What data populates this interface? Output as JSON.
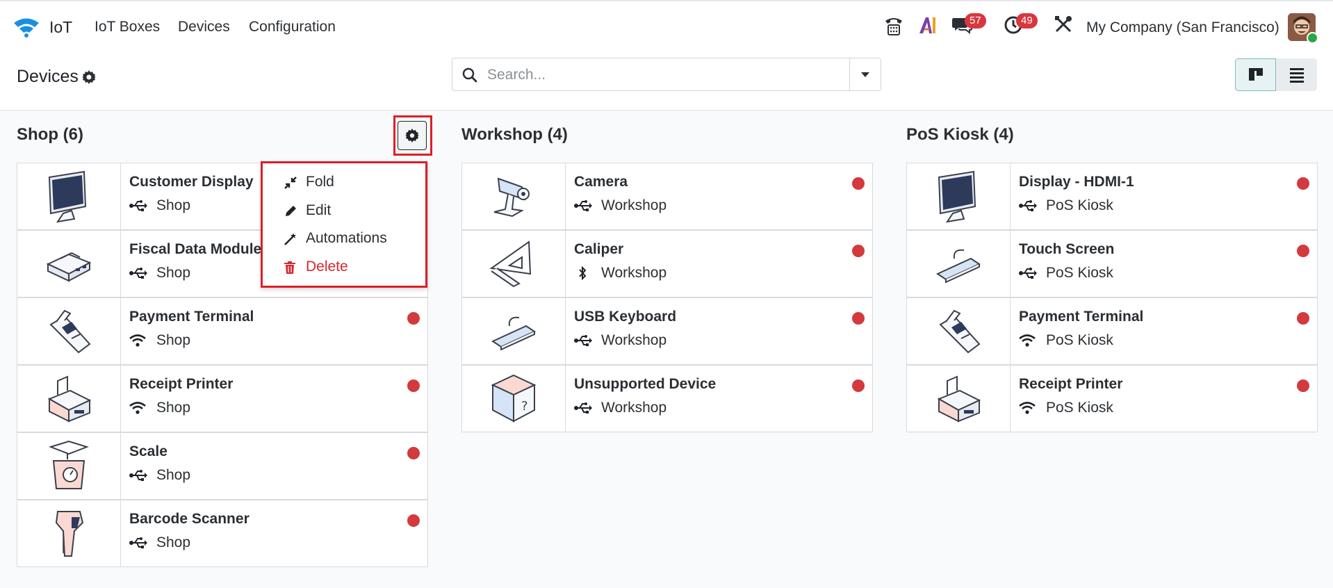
{
  "app": {
    "name": "IoT"
  },
  "nav": [
    {
      "label": "IoT Boxes"
    },
    {
      "label": "Devices"
    },
    {
      "label": "Configuration"
    }
  ],
  "systray": {
    "messages_count": "57",
    "activities_count": "49",
    "company": "My Company (San Francisco)"
  },
  "control": {
    "title": "Devices",
    "search_placeholder": "Search..."
  },
  "columns": [
    {
      "title": "Shop (6)",
      "cards": [
        {
          "name": "Customer Display",
          "location": "Shop",
          "connection": "usb-icon",
          "image": "monitor",
          "status_visible": false
        },
        {
          "name": "Fiscal Data Module",
          "location": "Shop",
          "connection": "usb-icon",
          "image": "module",
          "status_visible": false
        },
        {
          "name": "Payment Terminal",
          "location": "Shop",
          "connection": "wifi-icon",
          "image": "terminal",
          "status": "disconnected"
        },
        {
          "name": "Receipt Printer",
          "location": "Shop",
          "connection": "wifi-icon",
          "image": "printer",
          "status": "disconnected"
        },
        {
          "name": "Scale",
          "location": "Shop",
          "connection": "usb-icon",
          "image": "scale",
          "status": "disconnected"
        },
        {
          "name": "Barcode Scanner",
          "location": "Shop",
          "connection": "usb-icon",
          "image": "scanner",
          "status": "disconnected"
        }
      ]
    },
    {
      "title": "Workshop (4)",
      "cards": [
        {
          "name": "Camera",
          "location": "Workshop",
          "connection": "usb-icon",
          "image": "camera",
          "status": "disconnected"
        },
        {
          "name": "Caliper",
          "location": "Workshop",
          "connection": "bluetooth-icon",
          "image": "caliper",
          "status": "disconnected"
        },
        {
          "name": "USB Keyboard",
          "location": "Workshop",
          "connection": "usb-icon",
          "image": "keyboard",
          "status": "disconnected"
        },
        {
          "name": "Unsupported Device",
          "location": "Workshop",
          "connection": "usb-icon",
          "image": "unknown",
          "status": "disconnected"
        }
      ]
    },
    {
      "title": "PoS Kiosk (4)",
      "cards": [
        {
          "name": "Display - HDMI-1",
          "location": "PoS Kiosk",
          "connection": "usb-icon",
          "image": "monitor",
          "status": "disconnected"
        },
        {
          "name": "Touch Screen",
          "location": "PoS Kiosk",
          "connection": "usb-icon",
          "image": "keyboard",
          "status": "disconnected"
        },
        {
          "name": "Payment Terminal",
          "location": "PoS Kiosk",
          "connection": "wifi-icon",
          "image": "terminal",
          "status": "disconnected"
        },
        {
          "name": "Receipt Printer",
          "location": "PoS Kiosk",
          "connection": "wifi-icon",
          "image": "printer",
          "status": "disconnected"
        }
      ]
    }
  ],
  "column_menu": {
    "items": [
      {
        "label": "Fold",
        "icon": "compress-icon"
      },
      {
        "label": "Edit",
        "icon": "pencil-icon"
      },
      {
        "label": "Automations",
        "icon": "magic-wand-icon"
      },
      {
        "label": "Delete",
        "icon": "trash-icon"
      }
    ]
  },
  "colors": {
    "status_red": "#d4393d",
    "highlight_red": "#dc1f26",
    "accent_teal": "#017e84",
    "danger": "#d42a2f"
  }
}
